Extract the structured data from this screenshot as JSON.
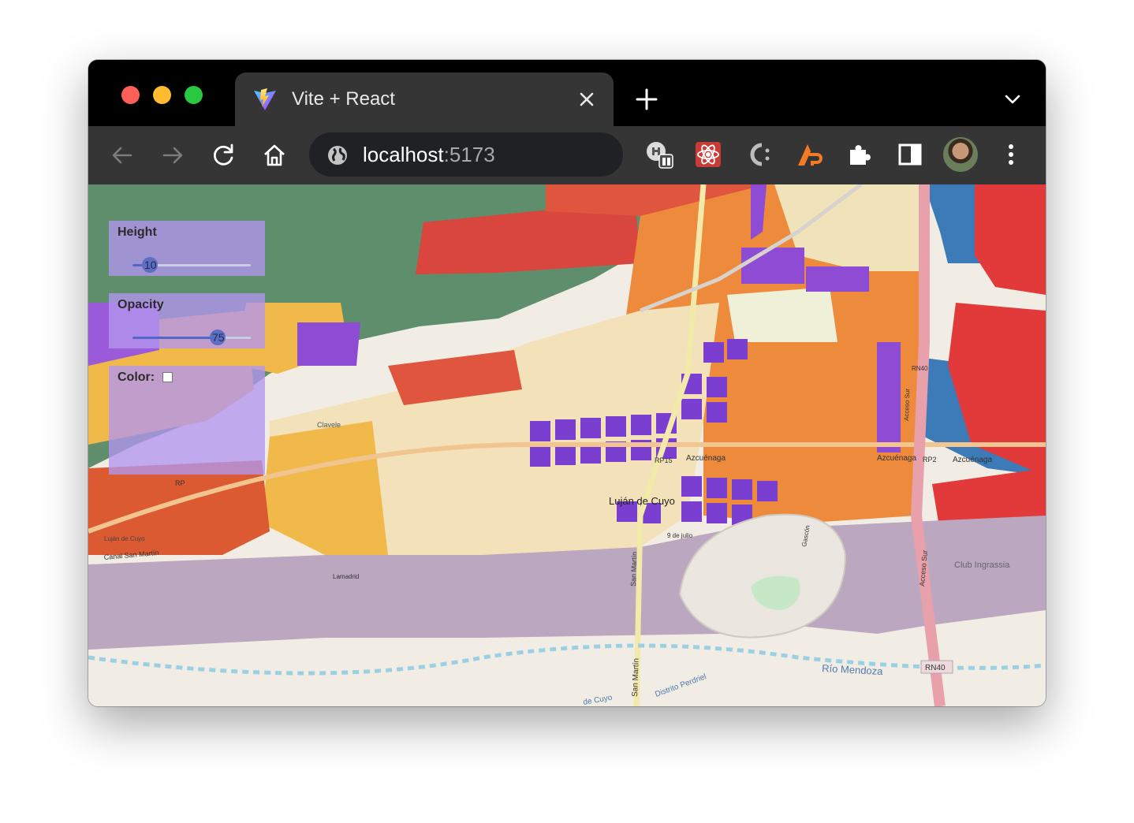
{
  "browser": {
    "tab_title": "Vite + React",
    "url_host": "localhost",
    "url_port": ":5173",
    "colors": {
      "frame": "#000000",
      "toolbar": "#353535",
      "omnibox": "#202124"
    }
  },
  "controls": {
    "height": {
      "label": "Height",
      "value": "10",
      "fraction": 0.1
    },
    "opacity": {
      "label": "Opacity",
      "value": "75",
      "fraction": 0.75
    },
    "color": {
      "label": "Color:",
      "checked": false
    }
  },
  "map_labels": {
    "clavel": "Clavele",
    "azcuenaga1": "Azcuénaga",
    "azcuenaga2": "Azcuénaga",
    "azcuenaga3": "Azcuénaga",
    "rp15": "RP15",
    "rp2": "RP2",
    "rp": "RP",
    "city": "Luján de Cuyo",
    "julio": "9 de julio",
    "sanmartin1": "San Martín",
    "sanmartin2": "San Martín",
    "accesosur1": "Acceso Sur",
    "accesosur2": "Acceso Sur",
    "rn40a": "RN40",
    "rn40b": "RN40",
    "club": "Club Ingrassia",
    "rio": "Río Mendoza",
    "distrito": "Distrito Perdriel",
    "decuyo": "de Cuyo",
    "canal": "Canal San Martín",
    "lujan_small": "Luján de Cuyo",
    "lamadrid": "Lamadrid",
    "gascon": "Gascón"
  },
  "icons": [
    "vite-icon",
    "close-icon",
    "plus-icon",
    "chevron-down-icon",
    "back-arrow-icon",
    "forward-arrow-icon",
    "reload-icon",
    "home-icon",
    "globe-icon",
    "extension-icon",
    "react-devtools-icon",
    "c-extension-icon",
    "ap-extension-icon",
    "puzzle-icon",
    "sidebar-icon",
    "kebab-menu-icon"
  ]
}
